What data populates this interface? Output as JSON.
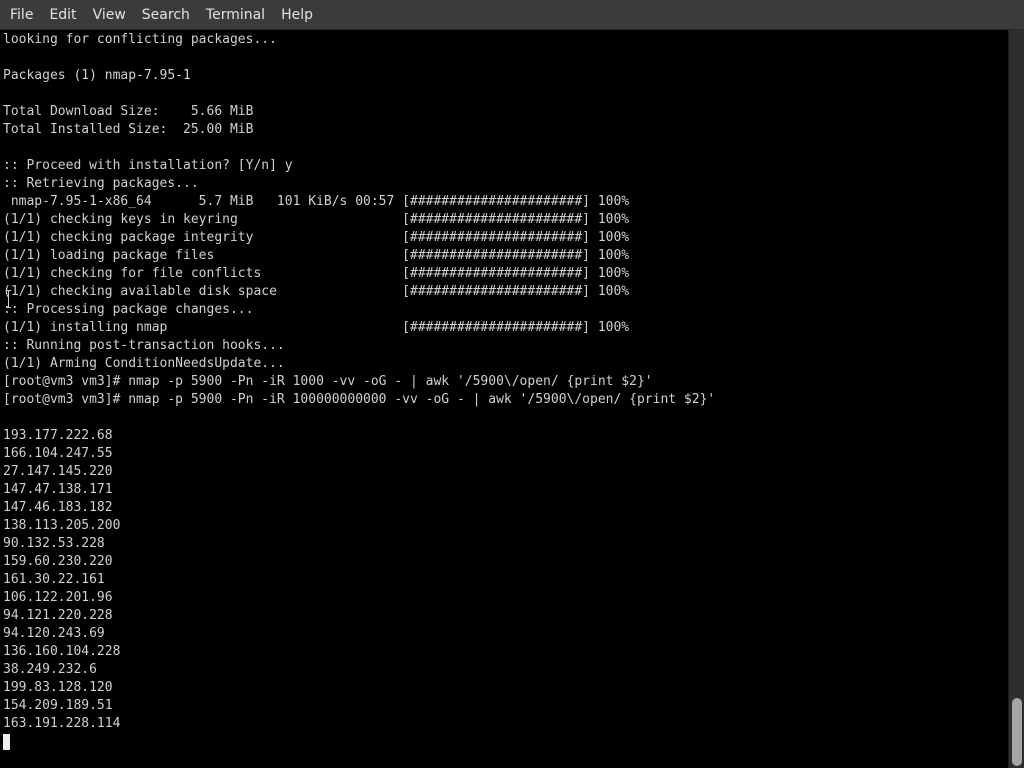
{
  "menu": [
    "File",
    "Edit",
    "View",
    "Search",
    "Terminal",
    "Help"
  ],
  "terminal": {
    "lines": [
      "looking for conflicting packages...",
      "",
      "Packages (1) nmap-7.95-1",
      "",
      "Total Download Size:    5.66 MiB",
      "Total Installed Size:  25.00 MiB",
      "",
      ":: Proceed with installation? [Y/n] y",
      ":: Retrieving packages...",
      " nmap-7.95-1-x86_64      5.7 MiB   101 KiB/s 00:57 [######################] 100%",
      "(1/1) checking keys in keyring                     [######################] 100%",
      "(1/1) checking package integrity                   [######################] 100%",
      "(1/1) loading package files                        [######################] 100%",
      "(1/1) checking for file conflicts                  [######################] 100%",
      "(1/1) checking available disk space                [######################] 100%",
      ":: Processing package changes...",
      "(1/1) installing nmap                              [######################] 100%",
      ":: Running post-transaction hooks...",
      "(1/1) Arming ConditionNeedsUpdate...",
      "[root@vm3 vm3]# nmap -p 5900 -Pn -iR 1000 -vv -oG - | awk '/5900\\/open/ {print $2}'",
      "[root@vm3 vm3]# nmap -p 5900 -Pn -iR 100000000000 -vv -oG - | awk '/5900\\/open/ {print $2}'",
      "",
      "193.177.222.68",
      "166.104.247.55",
      "27.147.145.220",
      "147.47.138.171",
      "147.46.183.182",
      "138.113.205.200",
      "90.132.53.228",
      "159.60.230.220",
      "161.30.22.161",
      "106.122.201.96",
      "94.121.220.228",
      "94.120.243.69",
      "136.160.104.228",
      "38.249.232.6",
      "199.83.128.120",
      "154.209.189.51",
      "163.191.228.114"
    ]
  },
  "colors": {
    "menubar_bg": "#3b3b3b",
    "terminal_bg": "#000000",
    "terminal_fg": "#d0d0d0"
  },
  "icons": {
    "cursor": "block-cursor",
    "pointer": "text-ibeam-pointer"
  }
}
